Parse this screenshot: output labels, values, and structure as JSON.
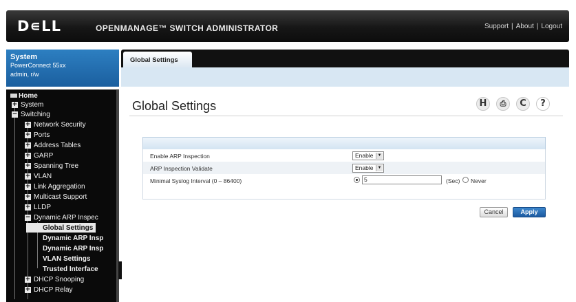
{
  "header": {
    "logo": "D∊LL",
    "app_title": "OPENMANAGE™ SWITCH ADMINISTRATOR",
    "links": {
      "support": "Support",
      "about": "About",
      "logout": "Logout",
      "separator": "|"
    }
  },
  "system_box": {
    "title": "System",
    "device": "PowerConnect 55xx",
    "user": "admin, r/w"
  },
  "tree": {
    "home": "Home",
    "system": "System",
    "switching": "Switching",
    "network_security": "Network Security",
    "ports": "Ports",
    "address_tables": "Address Tables",
    "garp": "GARP",
    "spanning_tree": "Spanning Tree",
    "vlan": "VLAN",
    "link_aggregation": "Link Aggregation",
    "multicast_support": "Multicast Support",
    "lldp": "LLDP",
    "dynamic_arp": "Dynamic ARP Inspec",
    "global_settings": "Global Settings",
    "dynamic_arp_insp_1": "Dynamic ARP Insp",
    "dynamic_arp_insp_2": "Dynamic ARP Insp",
    "vlan_settings": "VLAN Settings",
    "trusted_interface": "Trusted Interface",
    "dhcp_snooping": "DHCP Snooping",
    "dhcp_relay": "DHCP Relay",
    "expand": "+",
    "collapse": "−"
  },
  "tab": {
    "label": "Global Settings"
  },
  "page": {
    "title": "Global Settings",
    "icons": {
      "help_h": "H",
      "print": "⎙",
      "refresh": "C",
      "question": "?"
    }
  },
  "form": {
    "rows": [
      {
        "label": "Enable ARP Inspection",
        "value": "Enable"
      },
      {
        "label": "ARP Inspection Validate",
        "value": "Enable"
      },
      {
        "label": "Minimal Syslog Interval (0 – 86400)",
        "value": "5",
        "unit": "(Sec)",
        "alt_option": "Never"
      }
    ],
    "cancel": "Cancel",
    "apply": "Apply"
  }
}
